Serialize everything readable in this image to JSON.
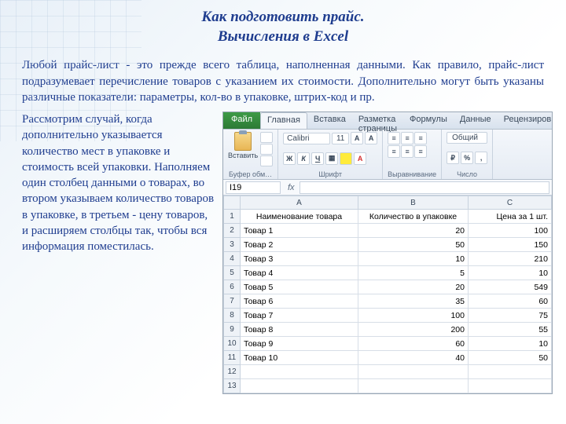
{
  "title": {
    "line1": "Как подготовить прайс.",
    "line2": "Вычисления в Excel"
  },
  "intro": "Любой прайс-лист - это прежде всего таблица, наполненная данными. Как правило, прайс-лист подразумевает перечисление товаров с указанием их стоимости. Дополнительно могут быть указаны различные показатели: параметры, кол-во в упаковке, штрих-код и пр.",
  "side": "Рассмотрим случай, когда дополнительно указывается количество мест в упаковке и стоимость всей упаковки. Наполняем один столбец данными о товарах, во втором указываем количество товаров в упаковке, в третьем - цену товаров, и расширяем столбцы так, чтобы вся информация поместилась.",
  "excel": {
    "tabs": {
      "file": "Файл",
      "home": "Главная",
      "insert": "Вставка",
      "layout": "Разметка страницы",
      "formulas": "Формулы",
      "data": "Данные",
      "review": "Рецензиров"
    },
    "ribbon": {
      "paste": "Вставить",
      "clipboard_label": "Буфер обм…",
      "font_name": "Calibri",
      "font_size": "11",
      "font_label": "Шрифт",
      "align_label": "Выравнивание",
      "num_format": "Общий",
      "num_label": "Число"
    },
    "namebox": "I19",
    "fx": "fx",
    "columns": {
      "A": "A",
      "B": "B",
      "C": "C"
    },
    "headers": {
      "name": "Наименование товара",
      "qty": "Количество в упаковке",
      "price": "Цена за 1 шт."
    },
    "rows": [
      {
        "n": "1"
      },
      {
        "n": "2",
        "a": "Товар 1",
        "b": "20",
        "c": "100"
      },
      {
        "n": "3",
        "a": "Товар 2",
        "b": "50",
        "c": "150"
      },
      {
        "n": "4",
        "a": "Товар 3",
        "b": "10",
        "c": "210"
      },
      {
        "n": "5",
        "a": "Товар 4",
        "b": "5",
        "c": "10"
      },
      {
        "n": "6",
        "a": "Товар 5",
        "b": "20",
        "c": "549"
      },
      {
        "n": "7",
        "a": "Товар 6",
        "b": "35",
        "c": "60"
      },
      {
        "n": "8",
        "a": "Товар 7",
        "b": "100",
        "c": "75"
      },
      {
        "n": "9",
        "a": "Товар 8",
        "b": "200",
        "c": "55"
      },
      {
        "n": "10",
        "a": "Товар 9",
        "b": "60",
        "c": "10"
      },
      {
        "n": "11",
        "a": "Товар 10",
        "b": "40",
        "c": "50"
      },
      {
        "n": "12"
      },
      {
        "n": "13"
      }
    ]
  }
}
